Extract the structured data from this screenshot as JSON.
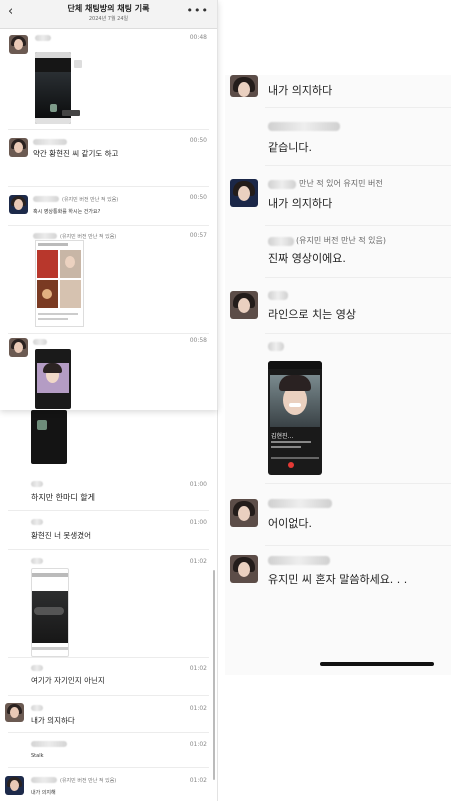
{
  "header": {
    "title": "단체 채팅방의 채팅 기록",
    "date": "2024년 7월 24일",
    "back_icon": "chevron-left-icon",
    "more_icon": "more-horizontal-icon"
  },
  "left_messages": [
    {
      "time": "00:48"
    },
    {
      "time": "00:50",
      "text": "약간 황현진 씨 같기도 하고"
    },
    {
      "time": "00:50",
      "name_extra": "(유지민 버전 만난 적 있음)",
      "text": "혹시 영상통화를 하시는 건가요?"
    },
    {
      "time": "00:57",
      "name_extra": "(유지민 버전 만난 적 있음)"
    },
    {
      "time": "00:58"
    }
  ],
  "left_bottom_messages": [
    {
      "time": "01:00",
      "text": "하지만 한마디 할게"
    },
    {
      "time": "01:00",
      "text": "황현진 너 못생겼어"
    },
    {
      "time": "01:02"
    },
    {
      "time": "01:02",
      "text": "여기가 자기인지 아닌지"
    },
    {
      "time": "01:02",
      "text": "내가 의지하다"
    },
    {
      "time": "01:02",
      "text": "Stalk"
    },
    {
      "time": "01:02",
      "name_extra": "(유지민 버전 만난 적 있음)",
      "text": "내가 의지해"
    }
  ],
  "right_messages": [
    {
      "text": "내가 의지하다"
    },
    {
      "text": "같습니다."
    },
    {
      "name_extra": "만난 적 있어 유지민 버전",
      "text": "내가 의지하다"
    },
    {
      "name_extra": "(유지민 버전 만난 적 있음)",
      "text": "진짜 영상이에요."
    },
    {
      "text": "라인으로 치는 영상"
    },
    {
      "text": "어이없다."
    },
    {
      "text": "유지민 씨 혼자 말씀하세요. . ."
    }
  ],
  "video_overlay_text": "김현진..."
}
